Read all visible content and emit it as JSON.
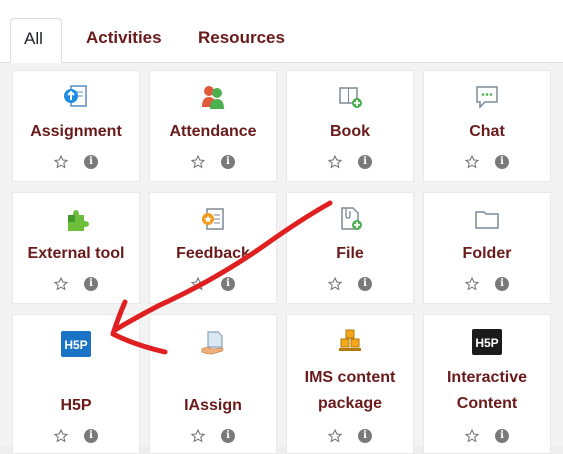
{
  "tabs": [
    {
      "label": "All",
      "active": true
    },
    {
      "label": "Activities",
      "active": false
    },
    {
      "label": "Resources",
      "active": false
    }
  ],
  "modules": [
    {
      "name": "Assignment",
      "icon": "assignment-icon"
    },
    {
      "name": "Attendance",
      "icon": "attendance-icon"
    },
    {
      "name": "Book",
      "icon": "book-icon"
    },
    {
      "name": "Chat",
      "icon": "chat-icon"
    },
    {
      "name": "External tool",
      "icon": "external-tool-icon"
    },
    {
      "name": "Feedback",
      "icon": "feedback-icon"
    },
    {
      "name": "File",
      "icon": "file-icon"
    },
    {
      "name": "Folder",
      "icon": "folder-icon"
    },
    {
      "name": "H5P",
      "icon": "h5p-icon",
      "badge": "H5P"
    },
    {
      "name": "IAssign",
      "icon": "iassign-icon"
    },
    {
      "name": "IMS content package",
      "name_lines": [
        "IMS content",
        "package"
      ],
      "icon": "ims-package-icon"
    },
    {
      "name": "Interactive Content",
      "name_lines": [
        "Interactive",
        "Content"
      ],
      "icon": "interactive-content-icon",
      "badge": "H5P"
    }
  ],
  "colors": {
    "accent_text": "#6a1a1a",
    "annotation": "#e02020"
  }
}
